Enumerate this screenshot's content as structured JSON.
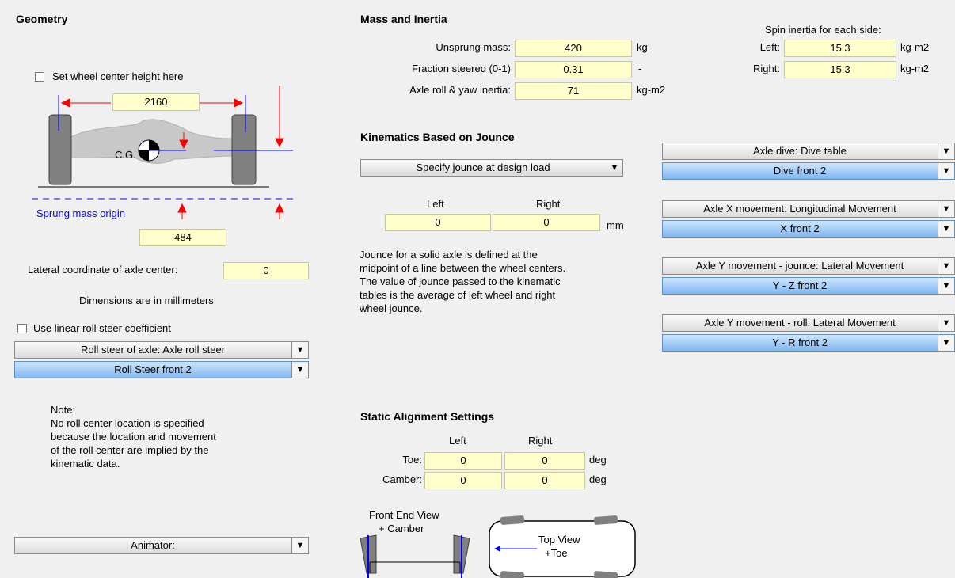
{
  "geometry": {
    "title": "Geometry",
    "set_height_label": "Set wheel center height here",
    "track_width": "2160",
    "cg_label": "C.G.",
    "sprung_origin_label": "Sprung mass origin",
    "height_value": "484",
    "lateral_label": "Lateral coordinate of axle center:",
    "lateral_value": "0",
    "units_note": "Dimensions are in millimeters",
    "linear_roll_label": "Use linear roll steer coefficient",
    "roll_steer_dropdown": "Roll steer of axle: Axle roll steer",
    "roll_steer_value": "Roll Steer front 2",
    "note_title": "Note:",
    "note_lines": [
      "No roll center location is specified",
      "because the location and movement",
      "of the roll center are implied by the",
      "kinematic data."
    ],
    "animator_label": "Animator:"
  },
  "mass": {
    "title": "Mass and Inertia",
    "unsprung_label": "Unsprung mass:",
    "unsprung_value": "420",
    "unsprung_unit": "kg",
    "fraction_label": "Fraction steered (0-1)",
    "fraction_value": "0.31",
    "fraction_unit": "-",
    "axle_inertia_label": "Axle roll & yaw inertia:",
    "axle_inertia_value": "71",
    "axle_inertia_unit": "kg-m2",
    "spin_title": "Spin inertia for each side:",
    "spin_left_label": "Left:",
    "spin_left_value": "15.3",
    "spin_right_label": "Right:",
    "spin_right_value": "15.3",
    "spin_unit": "kg-m2"
  },
  "kinematics": {
    "title": "Kinematics Based on Jounce",
    "jounce_dropdown": "Specify jounce at design load",
    "left_header": "Left",
    "right_header": "Right",
    "left_value": "0",
    "right_value": "0",
    "unit": "mm",
    "description_lines": [
      "Jounce for a solid axle is defined at the",
      "midpoint of a line between the wheel centers.",
      "The value of jounce passed to the kinematic",
      "tables is the average of left wheel and right",
      "wheel jounce."
    ]
  },
  "tables": [
    {
      "label": "Axle dive: Dive table",
      "value": "Dive front 2"
    },
    {
      "label": "Axle X movement: Longitudinal Movement",
      "value": "X front 2"
    },
    {
      "label": "Axle Y movement - jounce: Lateral Movement",
      "value": "Y - Z front 2"
    },
    {
      "label": "Axle Y movement - roll: Lateral Movement",
      "value": "Y - R front 2"
    }
  ],
  "alignment": {
    "title": "Static Alignment Settings",
    "left_header": "Left",
    "right_header": "Right",
    "toe_label": "Toe:",
    "toe_left": "0",
    "toe_right": "0",
    "toe_unit": "deg",
    "camber_label": "Camber:",
    "camber_left": "0",
    "camber_right": "0",
    "camber_unit": "deg",
    "front_view_label": "Front End View",
    "camber_sign": "+ Camber",
    "top_view_label": "Top View",
    "toe_sign": "+Toe"
  },
  "icons": {
    "dropdown": "chevron-down-icon",
    "checkbox": "checkbox-icon"
  },
  "colors": {
    "field_bg": "#ffffcc",
    "selected_bg": "#7fb6ef",
    "dimension_arrow": "#ff0000",
    "origin_line": "#0000ff"
  }
}
